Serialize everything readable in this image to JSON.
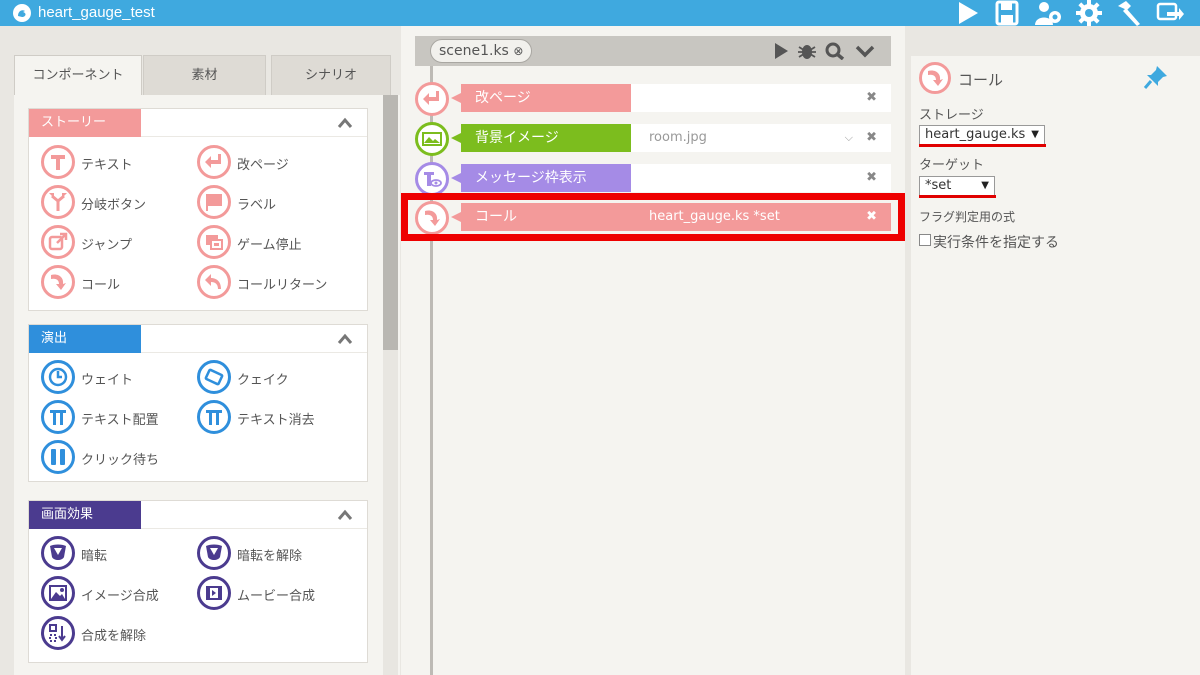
{
  "app": {
    "title": "heart_gauge_test"
  },
  "toolbar_icons": [
    "play-icon",
    "save-icon",
    "users-gear-icon",
    "gear-icon",
    "hammer-icon",
    "export-icon"
  ],
  "left_tabs": [
    "コンポーネント",
    "素材",
    "シナリオ"
  ],
  "sections": [
    {
      "title": "ストーリー",
      "color": "#f39a9a",
      "items": [
        "テキスト",
        "改ページ",
        "分岐ボタン",
        "ラベル",
        "ジャンプ",
        "ゲーム停止",
        "コール",
        "コールリターン"
      ]
    },
    {
      "title": "演出",
      "color": "#2f8fdc",
      "items": [
        "ウェイト",
        "クェイク",
        "テキスト配置",
        "テキスト消去",
        "クリック待ち"
      ]
    },
    {
      "title": "画面効果",
      "color": "#4b3b8f",
      "items": [
        "暗転",
        "暗転を解除",
        "イメージ合成",
        "ムービー合成",
        "合成を解除"
      ]
    }
  ],
  "scene": {
    "tab": "scene1.ks"
  },
  "timeline": [
    {
      "label": "改ページ",
      "value": "",
      "color": "#f39a9a",
      "has_dropdown": false
    },
    {
      "label": "背景イメージ",
      "value": "room.jpg",
      "color": "#7cbd1e",
      "has_dropdown": true
    },
    {
      "label": "メッセージ枠表示",
      "value": "",
      "color": "#a58be6",
      "has_dropdown": false
    },
    {
      "label": "コール",
      "value": "heart_gauge.ks *set",
      "color": "#f39a9a",
      "has_dropdown": false,
      "selected": true
    }
  ],
  "inspector": {
    "title": "コール",
    "storage_label": "ストレージ",
    "storage_value": "heart_gauge.ks",
    "target_label": "ターゲット",
    "target_value": "*set",
    "flag_label": "フラグ判定用の式",
    "condition_label": "実行条件を指定する"
  },
  "colors": {
    "titlebar": "#3fa9df",
    "highlight": "#ee0000",
    "pin": "#3fa9df"
  }
}
